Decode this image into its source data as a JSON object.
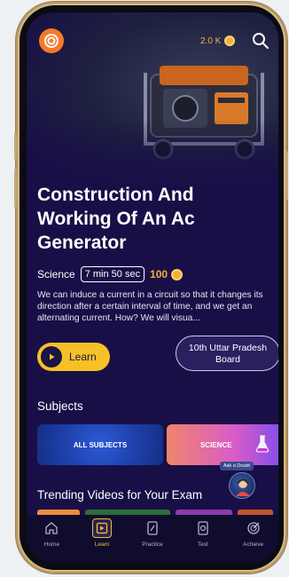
{
  "header": {
    "coins": "2.0 K"
  },
  "video": {
    "title": "Construction And Working Of An Ac Generator",
    "subject": "Science",
    "duration": "7 min 50 sec",
    "points": "100",
    "description": "We can induce a current in a circuit so that it changes its direction after a certain interval of time, and we get an alternating current. How? We will visua...",
    "learn_label": "Learn",
    "board_label": "10th Uttar Pradesh Board"
  },
  "subjects": {
    "title": "Subjects",
    "items": [
      "ALL SUBJECTS",
      "SCIENCE"
    ]
  },
  "doubt": {
    "label": "Ask a Doubt"
  },
  "trending": {
    "title": "Trending Videos for Your Exam"
  },
  "nav": {
    "items": [
      "Home",
      "Learn",
      "Practice",
      "Test",
      "Achieve"
    ],
    "active": "Learn"
  },
  "colors": {
    "background": "#180f47",
    "accent": "#f6c026",
    "coin": "#f2b233",
    "brand_logo": "#f47b2a"
  },
  "icons": [
    "logo-icon",
    "coin-icon",
    "search-icon",
    "play-icon",
    "flask-icon",
    "home-icon",
    "learn-icon",
    "practice-icon",
    "test-icon",
    "achieve-icon"
  ]
}
